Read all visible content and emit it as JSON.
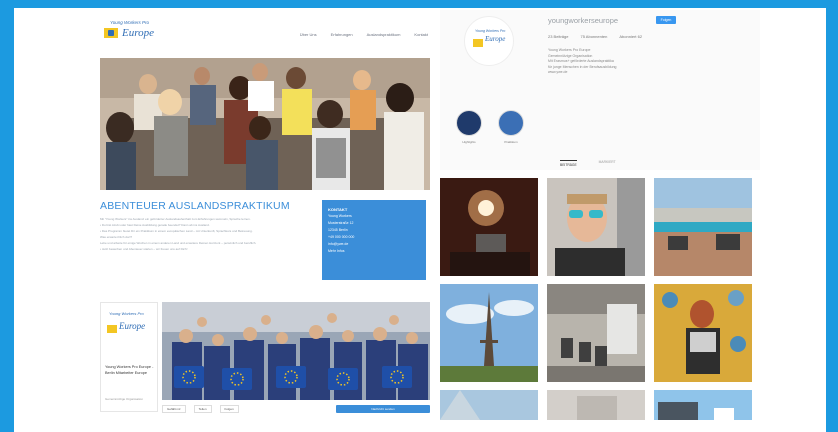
{
  "website": {
    "logo": {
      "tagline": "Young Workers Pro",
      "wordmark": "Europe"
    },
    "nav": [
      "Über Uns",
      "Erfahrungen",
      "Auslandspraktikum",
      "Kontakt"
    ],
    "title": "ABENTEUER AUSLANDSPRAKTIKUM",
    "body_lines": [
      "Mit \"Young Workers\" ins Ausland: ein geförderter Auslandsaufenthalt zum Erfahrungen sammeln, Sprache lernen.",
      "",
      "• Du bist Azubi oder hast Deine Ausbildung gerade beendet? Dann ab ins Ausland.",
      "• Das Programm bietet Dir ein Praktikum in einem europäischen Land – mit Unterkunft, Sprachkurs und Betreuung.",
      "",
      "Was erwartet Dich dort?",
      "",
      "Lebe und arbeite für einige Wochen in einem anderen Land und erweitere Deinen Horizont – persönlich und beruflich.",
      "",
      "• Jetzt bewerben und Abenteuer starten – wir freuen uns auf Dich!"
    ],
    "contact": {
      "title": "KONTAKT",
      "lines": [
        "Young Workers",
        "Musterstraße 12",
        "12345 Berlin",
        "",
        "+49 000 000 000",
        "",
        "info@ywe.de",
        "",
        "Mehr Infos"
      ]
    },
    "facebook": {
      "logo_tagline": "Young Workers Pro",
      "logo_word": "Europe",
      "page_name": "Young Workers Pro Europe - Berlin Mitarbeiter Europe",
      "page_sub": "Gemeinnützige Organisation",
      "bar_items": [
        "Gefällt mir",
        "Teilen",
        "Folgen"
      ],
      "cta": "Nachricht senden"
    }
  },
  "instagram": {
    "username": "youngworkerseurope",
    "follow_label": "Folgen",
    "stats": [
      "23 Beiträge",
      "75 Abonnenten",
      "Abonniert 62"
    ],
    "bio": [
      "Young Workers Pro Europe",
      "Gemeinnützige Organisation",
      "Mit Erasmus+ geförderte Auslandspraktika",
      "für junge Menschen in der Berufsausbildung",
      "www.ywe.de"
    ],
    "highlights": [
      {
        "label": "Highlights",
        "color": "#1f3a6b"
      },
      {
        "label": "Praktikum",
        "color": "#3b6fb5"
      }
    ],
    "tabs": [
      "BEITRÄGE",
      "MARKIERT"
    ],
    "active_tab": "BEITRÄGE"
  }
}
